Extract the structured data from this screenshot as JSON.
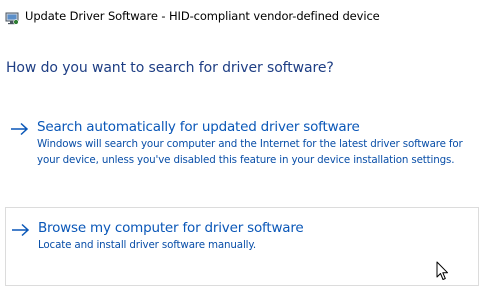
{
  "window": {
    "title": "Update Driver Software - HID-compliant vendor-defined device",
    "icon": "device-manager-icon"
  },
  "heading": "How do you want to search for driver software?",
  "options": [
    {
      "title": "Search automatically for updated driver software",
      "description": "Windows will search your computer and the Internet for the latest driver software for your device, unless you've disabled this feature in your device installation settings.",
      "icon": "arrow-right-icon"
    },
    {
      "title": "Browse my computer for driver software",
      "description": "Locate and install driver software manually.",
      "icon": "arrow-right-icon"
    }
  ],
  "colors": {
    "heading": "#1e3e84",
    "link": "#0a57b8",
    "description": "#0a4fa8",
    "hover_border": "#dcdcdc"
  }
}
